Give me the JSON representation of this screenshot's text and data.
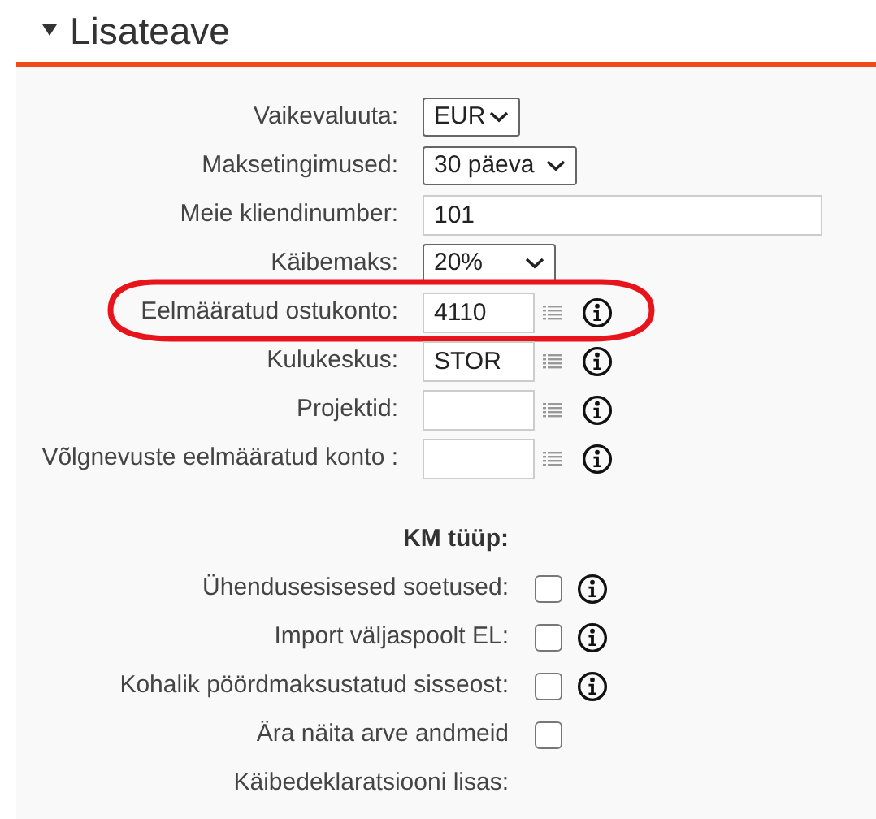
{
  "section": {
    "title": "Lisateave",
    "expanded": true
  },
  "fields": [
    {
      "kind": "select",
      "label": "Vaikevaluuta:",
      "value": "EUR",
      "highlighted": false
    },
    {
      "kind": "select",
      "label": "Maksetingimused:",
      "value": "30 päeva",
      "highlighted": false
    },
    {
      "kind": "text",
      "label": "Meie kliendinumber:",
      "value": "101",
      "highlighted": false
    },
    {
      "kind": "select",
      "label": "Käibemaks:",
      "value": "20%",
      "highlighted": false
    },
    {
      "kind": "lookup",
      "label": "Eelmääratud ostukonto:",
      "value": "4110",
      "highlighted": true
    },
    {
      "kind": "lookup",
      "label": "Kulukeskus:",
      "value": "STOR",
      "highlighted": false
    },
    {
      "kind": "lookup",
      "label": "Projektid:",
      "highlighted": false
    },
    {
      "kind": "lookup",
      "label": "Võlgnevuste eelmääratud konto :",
      "highlighted": false
    }
  ],
  "vat": {
    "heading": "KM tüüp:",
    "options": [
      {
        "kind": "checkbox",
        "label": "Ühendusesisesed soetused:",
        "checked": false,
        "info": true
      },
      {
        "kind": "checkbox",
        "label": "Import väljaspoolt EL:",
        "checked": false,
        "info": true
      },
      {
        "kind": "checkbox",
        "label": "Kohalik pöördmaksustatud sisseost:",
        "checked": false,
        "info": true
      },
      {
        "kind": "checkbox",
        "label": "Ära näita arve andmeid",
        "checked": false,
        "info": false
      },
      {
        "kind": "label",
        "label": "Käibedeklaratsiooni lisas:"
      }
    ]
  }
}
